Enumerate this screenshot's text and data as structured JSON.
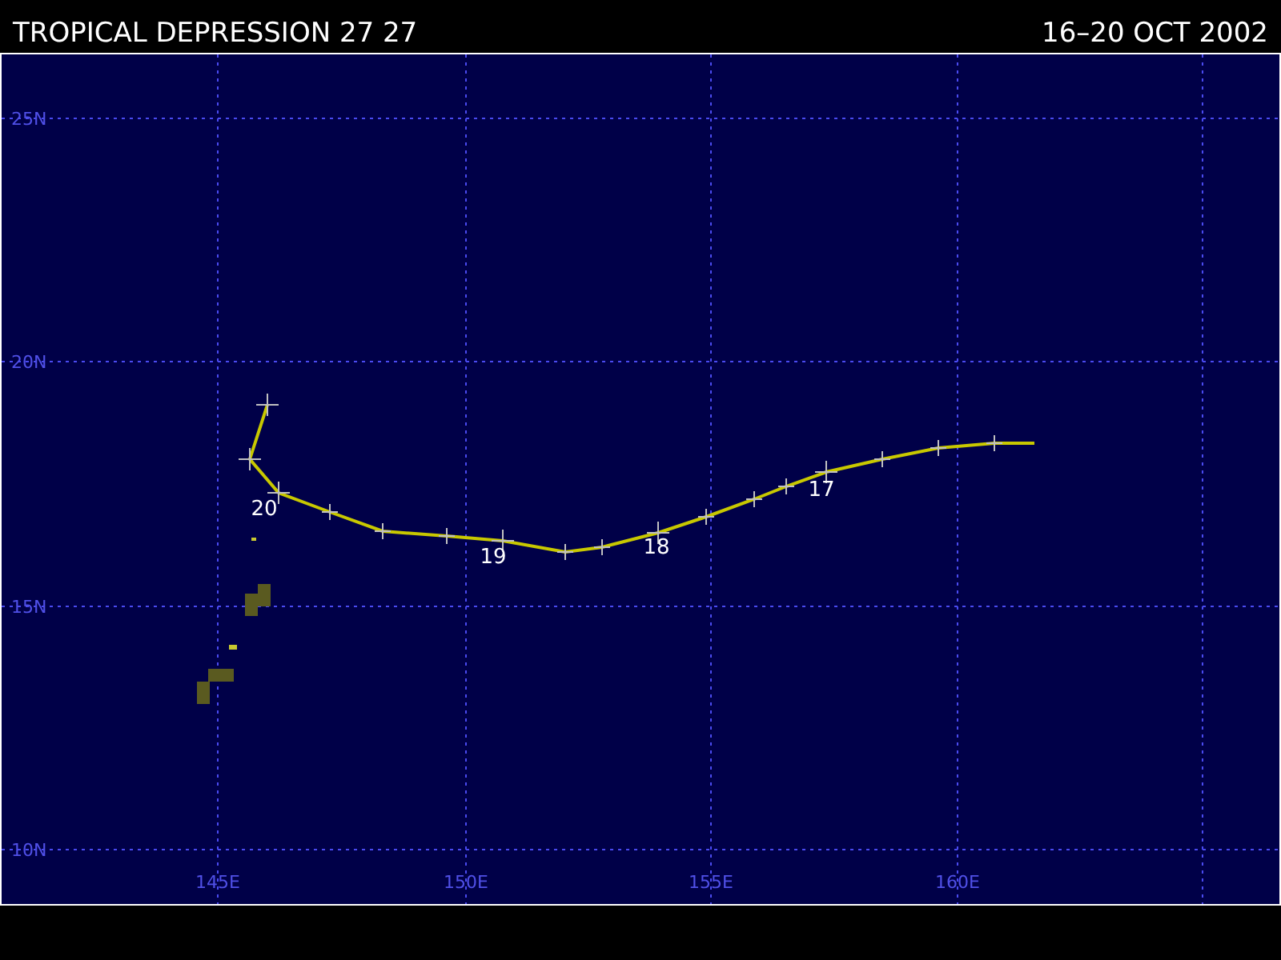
{
  "header": {
    "title": "TROPICAL DEPRESSION 27 27",
    "date_range": "16–20 OCT 2002"
  },
  "map": {
    "lat_labels": [
      "25N",
      "20N",
      "15N",
      "10N"
    ],
    "lon_labels": [
      "145E",
      "150E",
      "155E",
      "160E"
    ],
    "day_labels": [
      "20",
      "19",
      "18",
      "17"
    ]
  }
}
